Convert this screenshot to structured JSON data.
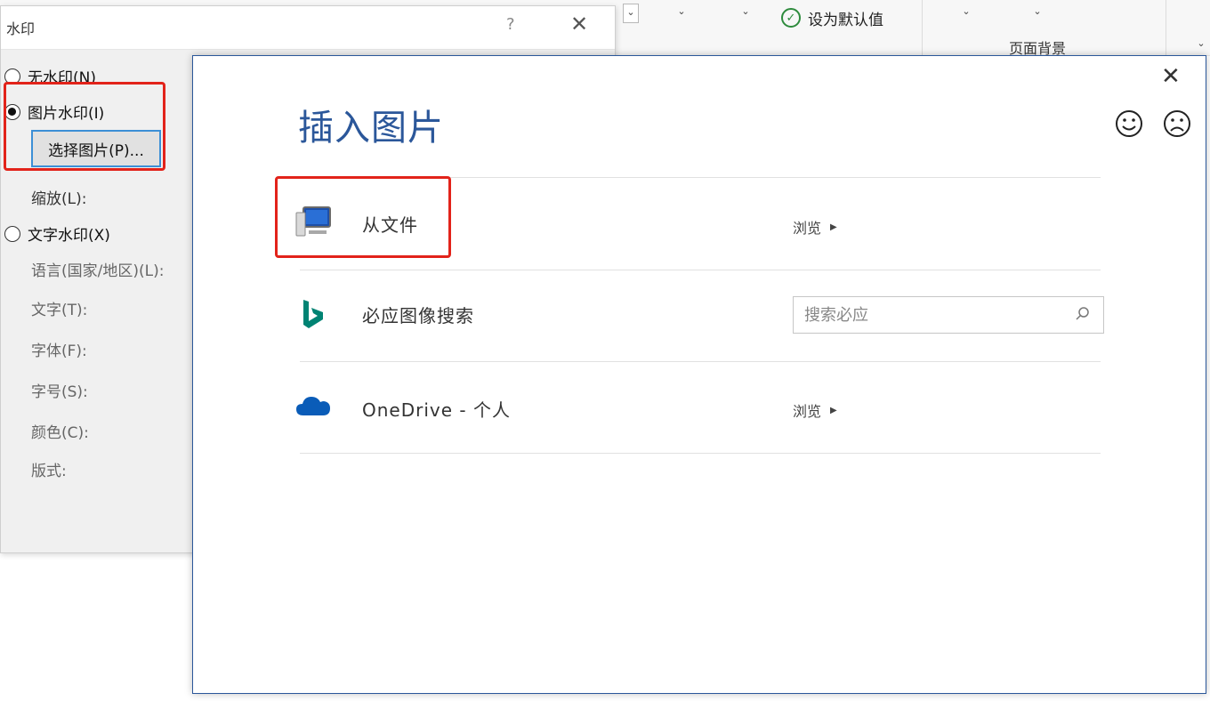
{
  "ribbon": {
    "set_default_label": "设为默认值",
    "page_background_label": "页面背景",
    "dropdown_glyph": "⌄",
    "collapse_glyph": "⌄",
    "check_glyph": "✓"
  },
  "watermark_dialog": {
    "title": "水印",
    "help_glyph": "?",
    "close_glyph": "✕",
    "options": [
      {
        "label": "无水印(N)",
        "selected": false
      },
      {
        "label": "图片水印(I)",
        "selected": true
      },
      {
        "label": "文字水印(X)",
        "selected": false
      }
    ],
    "select_picture_button": "选择图片(P)...",
    "scale_label": "缩放(L):",
    "text_fields": [
      "语言(国家/地区)(L):",
      "文字(T):",
      "字体(F):",
      "字号(S):",
      "颜色(C):",
      "版式:"
    ]
  },
  "insert_picture_dialog": {
    "title": "插入图片",
    "close_glyph": "✕",
    "feedback_icons": [
      "smile-icon",
      "frown-icon"
    ],
    "sources": [
      {
        "label": "从文件",
        "action_label": "浏览",
        "icon": "computer-icon"
      },
      {
        "label": "必应图像搜索",
        "search_placeholder": "搜索必应",
        "icon": "bing-icon"
      },
      {
        "label": "OneDrive - 个人",
        "action_label": "浏览",
        "icon": "onedrive-cloud-icon"
      }
    ]
  },
  "colors": {
    "accent_blue": "#2b579a",
    "highlight_red": "#e2231a",
    "button_focus": "#3c8fd6",
    "bing_teal": "#008373",
    "onedrive_blue": "#0a5cb8",
    "check_green": "#2e8b3d"
  }
}
